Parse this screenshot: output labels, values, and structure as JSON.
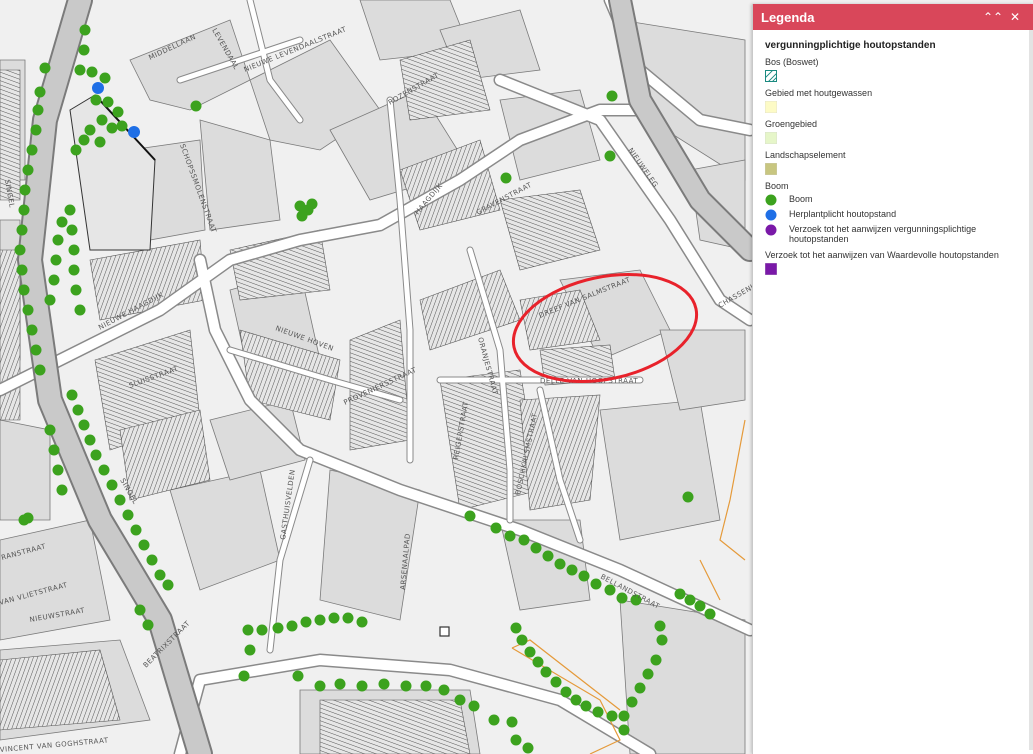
{
  "legend": {
    "title": "Legenda",
    "layer_title": "vergunningplichtige houtopstanden",
    "groups": [
      {
        "label": "Bos (Boswet)",
        "items": [
          {
            "symbol": "hatch",
            "label": ""
          }
        ]
      },
      {
        "label": "Gebied met houtgewassen",
        "items": [
          {
            "symbol": "square",
            "color": "#fdfbc6",
            "label": ""
          }
        ]
      },
      {
        "label": "Groengebied",
        "items": [
          {
            "symbol": "square",
            "color": "#e6f6c9",
            "label": ""
          }
        ]
      },
      {
        "label": "Landschapselement",
        "items": [
          {
            "symbol": "square",
            "color": "#c8c680",
            "label": ""
          }
        ]
      },
      {
        "label": "Boom",
        "items": [
          {
            "symbol": "circle",
            "color": "#3ca21e",
            "label": "Boom"
          },
          {
            "symbol": "circle",
            "color": "#1f6fe6",
            "label": "Herplantplicht houtopstand"
          },
          {
            "symbol": "circle",
            "color": "#7a19a8",
            "label": "Verzoek tot het aanwijzen vergunningsplichtige houtopstanden"
          }
        ]
      },
      {
        "label": "Verzoek tot het aanwijzen van Waardevolle houtopstanden",
        "items": [
          {
            "symbol": "square",
            "color": "#7a19a8",
            "label": ""
          }
        ]
      }
    ]
  },
  "map": {
    "street_labels": [
      "MIDDELLAAN",
      "LEVENDAAL",
      "NIEUWE LEVENDAALSTRAAT",
      "ROZENSTRAAT",
      "SCHOPSSMOLENSTRAAT",
      "HAAGDIJK",
      "GRAVENSTRAAT",
      "NIEUWE HAAGDIJK",
      "NIEUWELEG",
      "DREEF VAN SALMSTRAAT",
      "ORANJESTRAAT",
      "NIEUWE HOVEN",
      "SLUISSTRAAT",
      "PROVENIERSSTRAAT",
      "DELLE VAN HOOPSTRAAT",
      "REIGERSTRAAT",
      "BOSCHKALSMSTRAAT",
      "GASTHUISVELDEN",
      "ARSENAALPAD",
      "SINGEL",
      "VAN VLIETSTRAAT",
      "NIEUWSTRAAT",
      "BEATRIXSTRAAT",
      "VINCENT VAN GOGHSTRAAT",
      "SINGEL",
      "RANSTRAAT",
      "BELLANDSTRAAT",
      "CHASSENINGEL"
    ],
    "colors": {
      "tree": "#3ca21e",
      "replant": "#1f6fe6",
      "highlight": "#e8222b",
      "plan_outline": "#e59a3a"
    }
  }
}
